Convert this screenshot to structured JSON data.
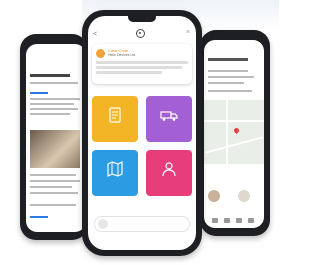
{
  "center": {
    "back_label": "<",
    "close_label": "×",
    "alert": {
      "title": "Case Code",
      "subtitle": "Hello Devices Ltd",
      "body": ""
    },
    "tiles": [
      {
        "label": "",
        "color": "#f3b526",
        "icon": "document-icon"
      },
      {
        "label": "",
        "color": "#a35fd4",
        "icon": "truck-icon"
      },
      {
        "label": "",
        "color": "#2b9be3",
        "icon": "map-icon"
      },
      {
        "label": "",
        "color": "#e83d7b",
        "icon": "person-icon"
      }
    ],
    "search_placeholder": ""
  }
}
